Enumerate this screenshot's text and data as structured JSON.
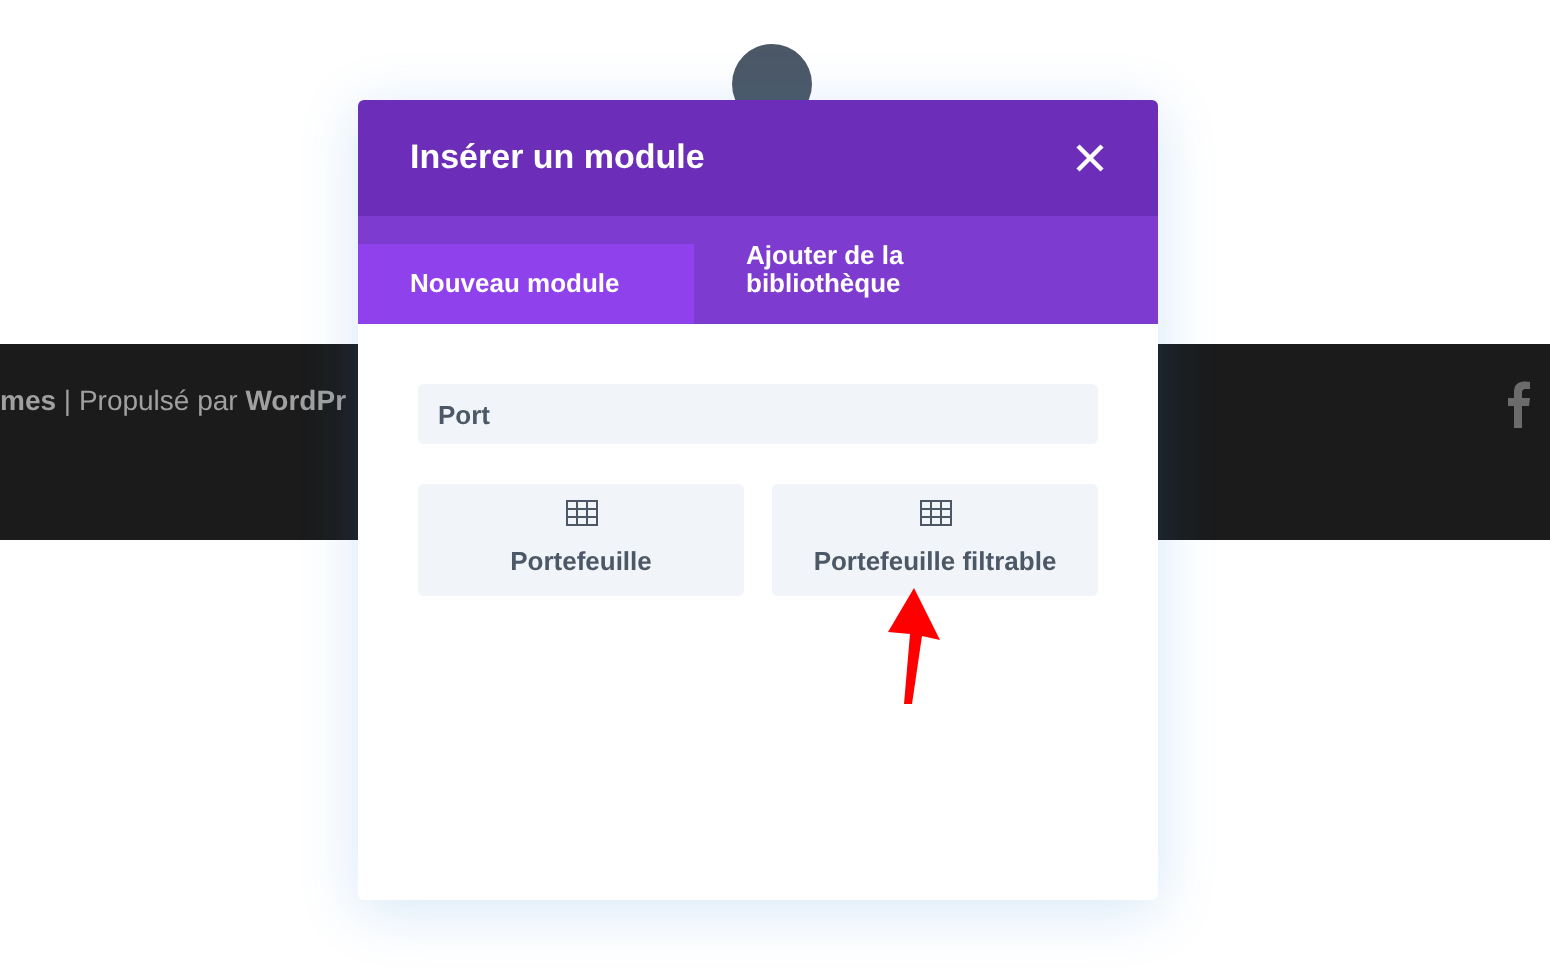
{
  "footer": {
    "credit": "**mes** | Propulsé par **WordPr**"
  },
  "modal": {
    "title": "Insérer un module",
    "tabs": [
      {
        "label": "Nouveau module",
        "selected": true
      },
      {
        "label": "Ajouter de la bibliothèque",
        "selected": false
      }
    ],
    "search": {
      "value": "Port"
    },
    "modules": [
      {
        "label": "Portefeuille"
      },
      {
        "label": "Portefeuille filtrable"
      }
    ]
  }
}
